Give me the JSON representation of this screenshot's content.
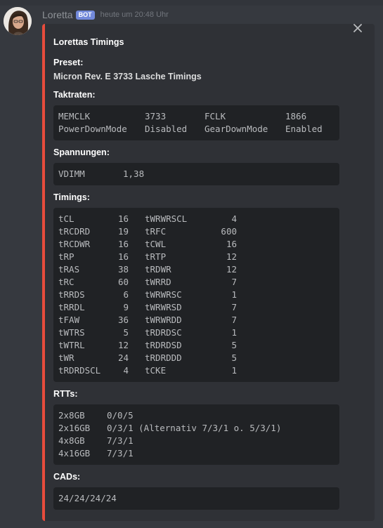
{
  "message": {
    "username": "Loretta",
    "bot_tag": "BOT",
    "timestamp": "heute um 20:48 Uhr"
  },
  "embed": {
    "accent_color": "#e74c3c",
    "title": "Lorettas Timings",
    "preset_label": "Preset:",
    "preset_value": "Micron Rev. E 3733 Lasche Timings",
    "taktraten_label": "Taktraten:",
    "taktraten": [
      [
        "MEMCLK",
        "3733",
        "FCLK",
        "1866"
      ],
      [
        "PowerDownMode",
        "Disabled",
        "GearDownMode",
        "Enabled"
      ]
    ],
    "spannungen_label": "Spannungen:",
    "spannungen": [
      [
        "VDIMM",
        "1,38"
      ]
    ],
    "timings_label": "Timings:",
    "timings": [
      [
        "tCL",
        "16",
        "tWRWRSCL",
        "4"
      ],
      [
        "tRCDRD",
        "19",
        "tRFC",
        "600"
      ],
      [
        "tRCDWR",
        "16",
        "tCWL",
        "16"
      ],
      [
        "tRP",
        "16",
        "tRTP",
        "12"
      ],
      [
        "tRAS",
        "38",
        "tRDWR",
        "12"
      ],
      [
        "tRC",
        "60",
        "tWRRD",
        "7"
      ],
      [
        "tRRDS",
        "6",
        "tWRWRSC",
        "1"
      ],
      [
        "tRRDL",
        "9",
        "tWRWRSD",
        "7"
      ],
      [
        "tFAW",
        "36",
        "tWRWRDD",
        "7"
      ],
      [
        "tWTRS",
        "5",
        "tRDRDSC",
        "1"
      ],
      [
        "tWTRL",
        "12",
        "tRDRDSD",
        "5"
      ],
      [
        "tWR",
        "24",
        "tRDRDDD",
        "5"
      ],
      [
        "tRDRDSCL",
        "4",
        "tCKE",
        "1"
      ]
    ],
    "rtts_label": "RTTs:",
    "rtts": [
      [
        "2x8GB",
        "0/0/5"
      ],
      [
        "2x16GB",
        "0/3/1 (Alternativ 7/3/1 o. 5/3/1)"
      ],
      [
        "4x8GB",
        "7/3/1"
      ],
      [
        "4x16GB",
        "7/3/1"
      ]
    ],
    "cads_label": "CADs:",
    "cads_value": "24/24/24/24"
  },
  "icons": {
    "close": "close-icon",
    "avatar": "avatar"
  }
}
